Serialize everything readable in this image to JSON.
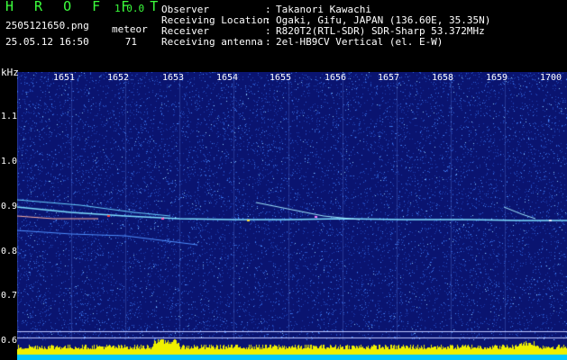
{
  "header": {
    "app_title": "H R O F F T",
    "version": "1.0.0",
    "filename": "2505121650.png",
    "meteor_label": "meteor",
    "datetime": "25.05.12 16:50",
    "meteor_count": "71"
  },
  "station": [
    {
      "key": "Observer",
      "value": "Takanori Kawachi"
    },
    {
      "key": "Receiving Location",
      "value": "Ogaki, Gifu, JAPAN (136.60E, 35.35N)"
    },
    {
      "key": "Receiver",
      "value": "R820T2(RTL-SDR) SDR-Sharp 53.372MHz"
    },
    {
      "key": "Receiving antenna",
      "value": "2el-HB9CV Vertical (el. E-W)"
    }
  ],
  "axes": {
    "y_unit": "kHz",
    "y_ticks": [
      "1.1",
      "1.0",
      "0.9",
      "0.8",
      "0.7",
      "0.6"
    ],
    "x_ticks": [
      "1651",
      "1652",
      "1653",
      "1654",
      "1655",
      "1656",
      "1657",
      "1658",
      "1659",
      "1700"
    ]
  },
  "colors": {
    "title": "#3cff3c",
    "spectrogram_bg": "#0a1470",
    "carrier": "#7fe0ff",
    "level_bar": "#f0f000",
    "level_base": "#00c8ff"
  }
}
